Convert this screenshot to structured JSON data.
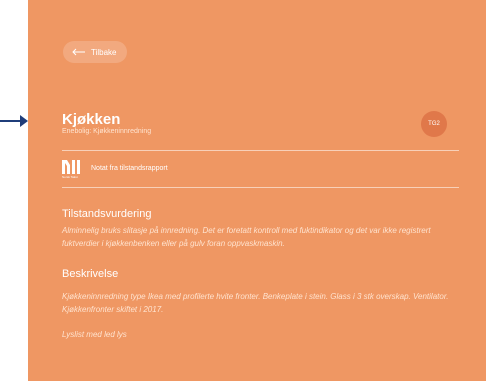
{
  "colors": {
    "panel_bg": "#EF9763",
    "badge_bg": "#E0784A",
    "pointer": "#1F3D7A"
  },
  "nav": {
    "back_label": "Tilbake",
    "back_icon": "arrow-left-icon"
  },
  "header": {
    "title": "Kjøkken",
    "subtitle": "Enebolig: Kjøkkeninnredning",
    "badge": "TG2"
  },
  "note": {
    "logo_text": "Norsk Takst",
    "label": "Notat fra tilstandsrapport"
  },
  "sections": [
    {
      "heading": "Tilstandsvurdering",
      "paragraphs": [
        "Alminnelig bruks slitasje på innredning. Det er foretatt  kontroll med fuktindikator og det var ikke registrert fuktverdier i kjøkkenbenken  eller på gulv foran oppvaskmaskin."
      ]
    },
    {
      "heading": "Beskrivelse",
      "paragraphs": [
        "Kjøkkeninnredning type Ikea med profilerte hvite fronter. Benkeplate i stein. Glass i 3 stk overskap. Ventilator. Kjøkkenfronter skiftet i 2017.",
        "Lyslist med led lys"
      ]
    }
  ]
}
